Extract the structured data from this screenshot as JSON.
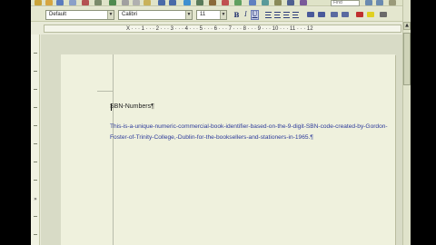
{
  "toolbar": {
    "find_placeholder": "Find"
  },
  "format_toolbar": {
    "paragraph_style": "Default",
    "font_name": "Calibri",
    "font_size": "11",
    "bold": "B",
    "italic": "I",
    "underline": "U",
    "dropdown_arrow": "▼"
  },
  "ruler": {
    "text": "X · · · 1 · · · 2 · · · 3 · · · 4 · · · 5 · · · 6 · · · 7 · · · 8 · · · 9 · · · 10 · · · 11 · · · 12"
  },
  "document": {
    "heading": "SBN-Numbers¶",
    "paragraph": "This-is-a-unique-numeric-commercial-book-identifier-based-on-the-9-digit-SBN-code-created-by-Gordon-Foster-of-Trinity-College,-Dublin-for-the-booksellers-and-stationers-in-1965.¶"
  },
  "colors": {
    "text_highlight": "#2c3a9a",
    "page_bg": "#eff1dd"
  }
}
